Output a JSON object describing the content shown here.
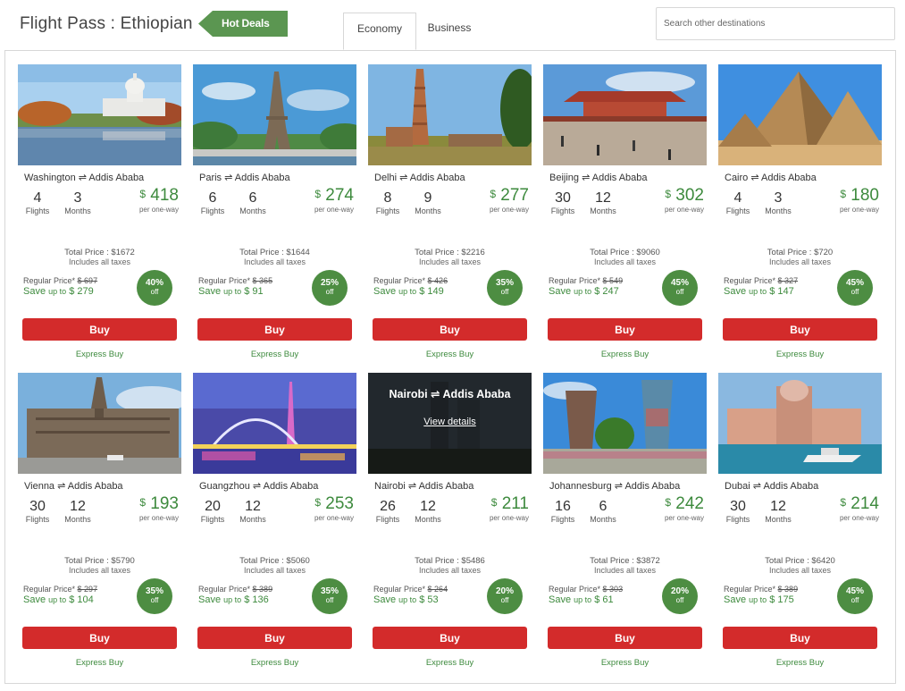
{
  "header": {
    "title": "Flight Pass : Ethiopian",
    "hot_deals": "Hot Deals",
    "tabs": [
      {
        "label": "Economy",
        "active": true
      },
      {
        "label": "Business",
        "active": false
      }
    ],
    "search_placeholder": "Search other destinations"
  },
  "labels": {
    "flights": "Flights",
    "months": "Months",
    "currency": "$",
    "per_one_way": "per one-way",
    "total_price": "Total Price :",
    "includes_taxes": "Includes all taxes",
    "regular_price": "Regular Price*",
    "save": "Save",
    "up_to": "up to",
    "off": "off",
    "buy": "Buy",
    "express_buy": "Express Buy",
    "view_details": "View details"
  },
  "colors": {
    "accent_green": "#3d8a3d",
    "badge_green": "#4d8d42",
    "buy_red": "#d32b2b"
  },
  "deals": [
    {
      "route": "Washington ⇌ Addis Ababa",
      "flights": "4",
      "months": "3",
      "price": "418",
      "total": "$1672",
      "regular": "$ 697",
      "save": "$ 279",
      "discount": "40%"
    },
    {
      "route": "Paris ⇌ Addis Ababa",
      "flights": "6",
      "months": "6",
      "price": "274",
      "total": "$1644",
      "regular": "$ 365",
      "save": "$ 91",
      "discount": "25%"
    },
    {
      "route": "Delhi ⇌ Addis Ababa",
      "flights": "8",
      "months": "9",
      "price": "277",
      "total": "$2216",
      "regular": "$ 426",
      "save": "$ 149",
      "discount": "35%"
    },
    {
      "route": "Beijing ⇌ Addis Ababa",
      "flights": "30",
      "months": "12",
      "price": "302",
      "total": "$9060",
      "regular": "$ 549",
      "save": "$ 247",
      "discount": "45%"
    },
    {
      "route": "Cairo ⇌ Addis Ababa",
      "flights": "4",
      "months": "3",
      "price": "180",
      "total": "$720",
      "regular": "$ 327",
      "save": "$ 147",
      "discount": "45%"
    },
    {
      "route": "Vienna ⇌ Addis Ababa",
      "flights": "30",
      "months": "12",
      "price": "193",
      "total": "$5790",
      "regular": "$ 297",
      "save": "$ 104",
      "discount": "35%"
    },
    {
      "route": "Guangzhou ⇌ Addis Ababa",
      "flights": "20",
      "months": "12",
      "price": "253",
      "total": "$5060",
      "regular": "$ 389",
      "save": "$ 136",
      "discount": "35%"
    },
    {
      "route": "Nairobi ⇌ Addis Ababa",
      "flights": "26",
      "months": "12",
      "price": "211",
      "total": "$5486",
      "regular": "$ 264",
      "save": "$ 53",
      "discount": "20%",
      "hover": true
    },
    {
      "route": "Johannesburg ⇌ Addis Ababa",
      "flights": "16",
      "months": "6",
      "price": "242",
      "total": "$3872",
      "regular": "$ 303",
      "save": "$ 61",
      "discount": "20%"
    },
    {
      "route": "Dubai ⇌ Addis Ababa",
      "flights": "30",
      "months": "12",
      "price": "214",
      "total": "$6420",
      "regular": "$ 389",
      "save": "$ 175",
      "discount": "45%"
    }
  ]
}
